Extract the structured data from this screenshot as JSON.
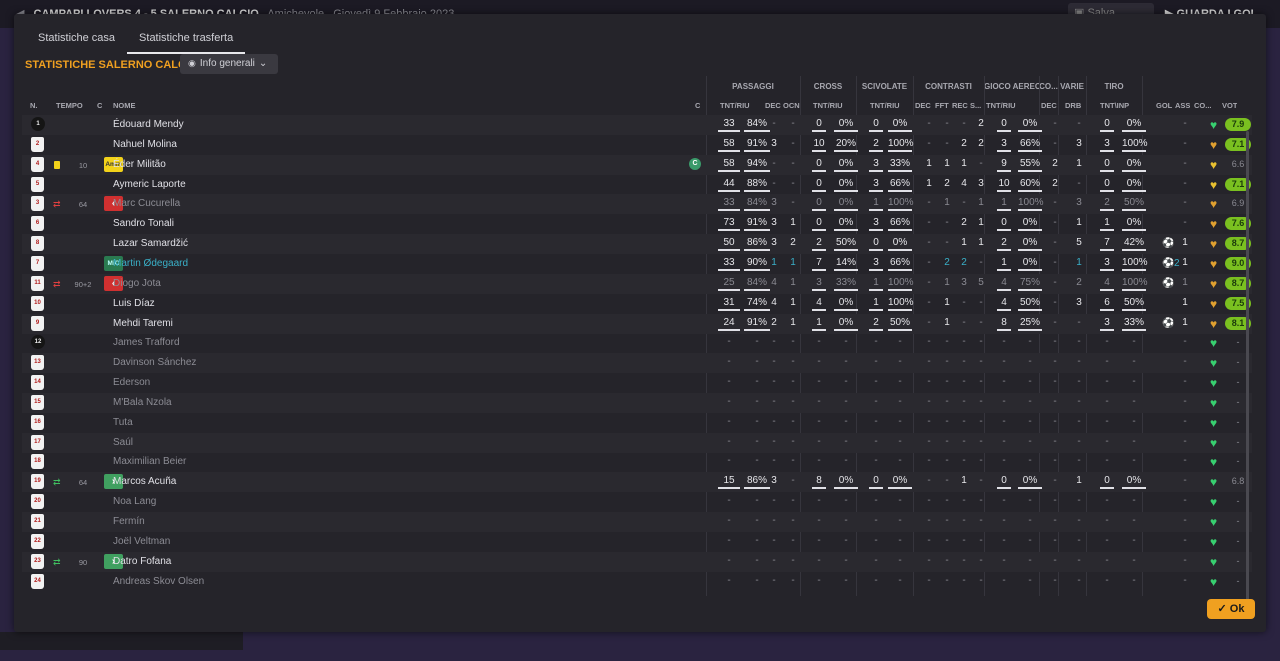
{
  "topbar": {
    "match": "CAMPAPI LOVERS 4 - 5 SALERNO CALCIO",
    "type": "Amichevole",
    "date": "Giovedì 9 Febbraio 2023",
    "save": "Salva partita",
    "watch": "GUARDA I GOL"
  },
  "tabs": [
    "Statistiche casa",
    "Statistiche trasferta"
  ],
  "team_title": "STATISTICHE SALERNO CALCIO",
  "info_button": "Info generali",
  "groups": [
    "PASSAGGI",
    "CROSS",
    "SCIVOLATE",
    "CONTRASTI",
    "GIOCO AEREO",
    "CO...",
    "VARIE",
    "TIRO"
  ],
  "headers": {
    "n": "N.",
    "tempo": "TEMPO",
    "c": "C",
    "nome": "NOME",
    "c2": "C",
    "pass": "TNT/RIU",
    "dec": "DEC",
    "ocn": "OCN",
    "cross": "TNT/RIU",
    "sciv": "TNT/RIU",
    "cdec": "DEC",
    "fft": "FFT",
    "rec": "REC",
    "s": "S...",
    "aereo": "TNT/RIU",
    "codec": "DEC",
    "drb": "DRB",
    "tiro": "TNT\\INP",
    "gol": "GOL",
    "ass": "ASS",
    "co": "CO...",
    "vot": "VOT"
  },
  "ok": "Ok",
  "players": [
    {
      "n": "1",
      "gk": true,
      "name": "Édouard Mendy",
      "pa": "33",
      "pp": "84%",
      "dec": "-",
      "ocn": "-",
      "ca": "0",
      "cp": "0%",
      "sa": "0",
      "sp": "0%",
      "cd": "-",
      "ff": "-",
      "rc": "-",
      "s": "2",
      "aa": "0",
      "ap": "0%",
      "co": "-",
      "drb": "-",
      "ta": "0",
      "tp": "0%",
      "gol": "",
      "ass": "-",
      "heart": "g",
      "vot": "7.9",
      "hi": true
    },
    {
      "n": "2",
      "name": "Nahuel Molina",
      "pa": "58",
      "pp": "91%",
      "dec": "3",
      "ocn": "-",
      "ca": "10",
      "cp": "20%",
      "sa": "2",
      "sp": "100%",
      "cd": "-",
      "ff": "-",
      "rc": "2",
      "s": "2",
      "aa": "3",
      "ap": "66%",
      "co": "-",
      "drb": "3",
      "ta": "3",
      "tp": "100%",
      "gol": "",
      "ass": "-",
      "heart": "o",
      "vot": "7.1",
      "hi": true
    },
    {
      "n": "4",
      "card": true,
      "tempo": "10",
      "pos": "Amm",
      "name": "Éder Militão",
      "capt": true,
      "pa": "58",
      "pp": "94%",
      "dec": "-",
      "ocn": "-",
      "ca": "0",
      "cp": "0%",
      "sa": "3",
      "sp": "33%",
      "cd": "1",
      "ff": "1",
      "rc": "1",
      "s": "-",
      "aa": "9",
      "ap": "55%",
      "co": "2",
      "drb": "1",
      "ta": "0",
      "tp": "0%",
      "gol": "",
      "ass": "-",
      "heart": "y",
      "vot": "6.6",
      "hi": false
    },
    {
      "n": "5",
      "name": "Aymeric Laporte",
      "pa": "44",
      "pp": "88%",
      "dec": "-",
      "ocn": "-",
      "ca": "0",
      "cp": "0%",
      "sa": "3",
      "sp": "66%",
      "cd": "1",
      "ff": "2",
      "rc": "4",
      "s": "3",
      "aa": "10",
      "ap": "60%",
      "co": "2",
      "drb": "-",
      "ta": "0",
      "tp": "0%",
      "gol": "",
      "ass": "-",
      "heart": "y",
      "vot": "7.1",
      "hi": true
    },
    {
      "n": "3",
      "sub": "out",
      "tempo": "64",
      "pos": "out",
      "name": "Marc Cucurella",
      "dim": true,
      "pa": "33",
      "pp": "84%",
      "dec": "3",
      "ocn": "-",
      "ca": "0",
      "cp": "0%",
      "sa": "1",
      "sp": "100%",
      "cd": "-",
      "ff": "1",
      "rc": "-",
      "s": "1",
      "aa": "1",
      "ap": "100%",
      "co": "-",
      "drb": "3",
      "ta": "2",
      "tp": "50%",
      "gol": "",
      "ass": "-",
      "heart": "o",
      "vot": "6.9",
      "hi": false
    },
    {
      "n": "6",
      "name": "Sandro Tonali",
      "pa": "73",
      "pp": "91%",
      "dec": "3",
      "ocn": "1",
      "ca": "0",
      "cp": "0%",
      "sa": "3",
      "sp": "66%",
      "cd": "-",
      "ff": "-",
      "rc": "2",
      "s": "1",
      "aa": "0",
      "ap": "0%",
      "co": "-",
      "drb": "1",
      "ta": "1",
      "tp": "0%",
      "gol": "",
      "ass": "-",
      "heart": "o",
      "vot": "7.6",
      "hi": true
    },
    {
      "n": "8",
      "name": "Lazar Samardžić",
      "pa": "50",
      "pp": "86%",
      "dec": "3",
      "ocn": "2",
      "ca": "2",
      "cp": "50%",
      "sa": "0",
      "sp": "0%",
      "cd": "-",
      "ff": "-",
      "rc": "1",
      "s": "1",
      "aa": "2",
      "ap": "0%",
      "co": "-",
      "drb": "5",
      "ta": "7",
      "tp": "42%",
      "gol": "ball",
      "ass": "1",
      "heart": "o",
      "vot": "8.7",
      "hi": true
    },
    {
      "n": "7",
      "pos": "MiC",
      "name": "Martin Ødegaard",
      "cyan": true,
      "pa": "33",
      "pp": "90%",
      "dec": "1",
      "ocn": "1",
      "ca": "7",
      "cp": "14%",
      "sa": "3",
      "sp": "66%",
      "cd": "-",
      "ff": "2",
      "rc": "2",
      "s": "-",
      "aa": "1",
      "ap": "0%",
      "co": "-",
      "drb": "1",
      "ta": "3",
      "tp": "100%",
      "gol": "ball2",
      "ass": "1",
      "heart": "o",
      "vot": "9.0",
      "hi": true,
      "cy": true
    },
    {
      "n": "11",
      "sub": "out",
      "tempo": "90+2",
      "pos": "out",
      "name": "Diogo Jota",
      "dim": true,
      "pa": "25",
      "pp": "84%",
      "dec": "4",
      "ocn": "1",
      "ca": "3",
      "cp": "33%",
      "sa": "1",
      "sp": "100%",
      "cd": "-",
      "ff": "1",
      "rc": "3",
      "s": "5",
      "aa": "4",
      "ap": "75%",
      "co": "-",
      "drb": "2",
      "ta": "4",
      "tp": "100%",
      "gol": "ball",
      "ass": "1",
      "heart": "o",
      "vot": "8.7",
      "hi": true
    },
    {
      "n": "10",
      "name": "Luis Díaz",
      "pa": "31",
      "pp": "74%",
      "dec": "4",
      "ocn": "1",
      "ca": "4",
      "cp": "0%",
      "sa": "1",
      "sp": "100%",
      "cd": "-",
      "ff": "1",
      "rc": "-",
      "s": "-",
      "aa": "4",
      "ap": "50%",
      "co": "-",
      "drb": "3",
      "ta": "6",
      "tp": "50%",
      "gol": "",
      "ass": "1",
      "heart": "o",
      "vot": "7.5",
      "hi": true
    },
    {
      "n": "9",
      "name": "Mehdi Taremi",
      "pa": "24",
      "pp": "91%",
      "dec": "2",
      "ocn": "1",
      "ca": "1",
      "cp": "0%",
      "sa": "2",
      "sp": "50%",
      "cd": "-",
      "ff": "1",
      "rc": "-",
      "s": "-",
      "aa": "8",
      "ap": "25%",
      "co": "-",
      "drb": "-",
      "ta": "3",
      "tp": "33%",
      "gol": "ball",
      "ass": "1",
      "heart": "o",
      "vot": "8.1",
      "hi": true
    },
    {
      "n": "12",
      "gk": true,
      "name": "James Trafford",
      "dim": true,
      "empty": true,
      "heart": "g"
    },
    {
      "n": "13",
      "name": "Davinson Sánchez",
      "dim": true,
      "empty": true,
      "heart": "g"
    },
    {
      "n": "14",
      "name": "Ederson",
      "dim": true,
      "empty": true,
      "heart": "g"
    },
    {
      "n": "15",
      "name": "M'Bala Nzola",
      "dim": true,
      "empty": true,
      "heart": "g"
    },
    {
      "n": "16",
      "name": "Tuta",
      "dim": true,
      "empty": true,
      "heart": "g"
    },
    {
      "n": "17",
      "name": "Saúl",
      "dim": true,
      "empty": true,
      "heart": "g"
    },
    {
      "n": "18",
      "name": "Maximilian Beier",
      "dim": true,
      "empty": true,
      "heart": "g"
    },
    {
      "n": "19",
      "sub": "in",
      "tempo": "64",
      "pos": "in",
      "name": "Marcos Acuña",
      "pa": "15",
      "pp": "86%",
      "dec": "3",
      "ocn": "-",
      "ca": "8",
      "cp": "0%",
      "sa": "0",
      "sp": "0%",
      "cd": "-",
      "ff": "-",
      "rc": "1",
      "s": "-",
      "aa": "0",
      "ap": "0%",
      "co": "-",
      "drb": "1",
      "ta": "0",
      "tp": "0%",
      "gol": "",
      "ass": "-",
      "heart": "g",
      "vot": "6.8",
      "hi": false
    },
    {
      "n": "20",
      "name": "Noa Lang",
      "dim": true,
      "empty": true,
      "heart": "g"
    },
    {
      "n": "21",
      "name": "Fermín",
      "dim": true,
      "empty": true,
      "heart": "g"
    },
    {
      "n": "22",
      "name": "Joël Veltman",
      "dim": true,
      "empty": true,
      "heart": "g"
    },
    {
      "n": "23",
      "sub": "in",
      "tempo": "90",
      "pos": "in",
      "name": "Datro Fofana",
      "empty": true,
      "heart": "g"
    },
    {
      "n": "24",
      "name": "Andreas Skov Olsen",
      "dim": true,
      "empty": true,
      "heart": "g"
    }
  ]
}
